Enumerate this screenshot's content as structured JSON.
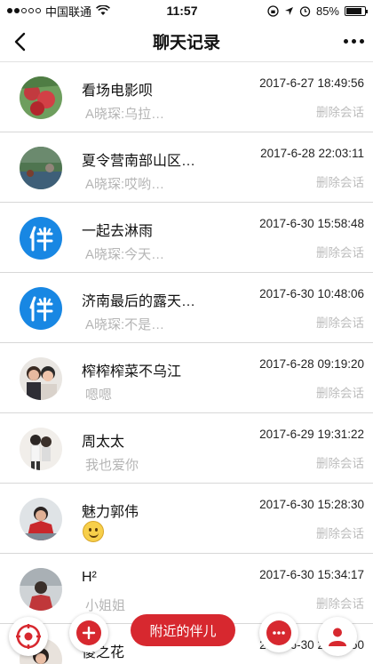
{
  "status_bar": {
    "carrier": "中国联通",
    "time": "11:57",
    "battery": "85%",
    "battery_level": 0.85
  },
  "header": {
    "title": "聊天记录"
  },
  "delete_label": "删除会话",
  "chats": [
    {
      "name": "看场电影呗",
      "time": "2017-6-27 18:49:56",
      "preview": "A晓琛:乌拉…",
      "avatar": "fruit-photo"
    },
    {
      "name": "夏令营南部山区…",
      "time": "2017-6-28 22:03:11",
      "preview": "A晓琛:哎哟…",
      "avatar": "landscape-photo"
    },
    {
      "name": "一起去淋雨",
      "time": "2017-6-30 15:58:48",
      "preview": "A晓琛:今天…",
      "avatar": "brand-logo"
    },
    {
      "name": "济南最后的露天…",
      "time": "2017-6-30 10:48:06",
      "preview": "A晓琛:不是…",
      "avatar": "brand-logo"
    },
    {
      "name": "榨榨榨菜不乌江",
      "time": "2017-6-28 09:19:20",
      "preview": "嗯嗯",
      "avatar": "couple-photo"
    },
    {
      "name": "周太太",
      "time": "2017-6-29 19:31:22",
      "preview": "我也爱你",
      "avatar": "couple-photo"
    },
    {
      "name": "魅力郭伟",
      "time": "2017-6-30 15:28:30",
      "preview": "",
      "avatar": "person-photo",
      "emoji": "smile-emoji"
    },
    {
      "name": "H²",
      "time": "2017-6-30 15:34:17",
      "preview": "小姐姐",
      "avatar": "person-photo"
    },
    {
      "name": "傻之花",
      "time": "2017-6-30 22:50:50",
      "preview": "",
      "avatar": "person-photo"
    }
  ],
  "bottom_bar": {
    "nearby_label": "附近的伴儿"
  }
}
